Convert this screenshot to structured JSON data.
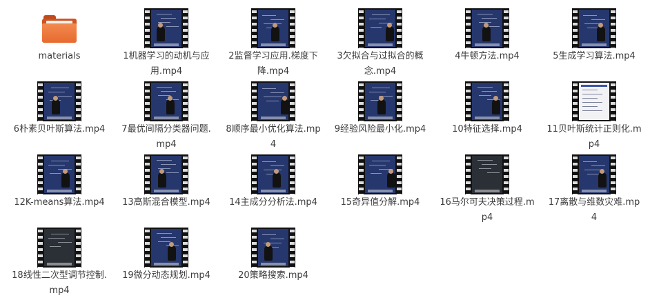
{
  "folder": {
    "name": "materials",
    "icon": "folder-icon",
    "color": "#e76a2f"
  },
  "videos": [
    {
      "name": "1机器学习的动机与应用.mp4",
      "thumb": "lecture"
    },
    {
      "name": "2监督学习应用.梯度下降.mp4",
      "thumb": "lecture"
    },
    {
      "name": "3欠拟合与过拟合的概念.mp4",
      "thumb": "lecture"
    },
    {
      "name": "4牛顿方法.mp4",
      "thumb": "lecture"
    },
    {
      "name": "5生成学习算法.mp4",
      "thumb": "lecture"
    },
    {
      "name": "6朴素贝叶斯算法.mp4",
      "thumb": "lecture"
    },
    {
      "name": "7最优间隔分类器问题.mp4",
      "thumb": "lecture"
    },
    {
      "name": "8顺序最小优化算法.mp4",
      "thumb": "lecture"
    },
    {
      "name": "9经验风险最小化.mp4",
      "thumb": "lecture"
    },
    {
      "name": "10特征选择.mp4",
      "thumb": "lecture"
    },
    {
      "name": "11贝叶斯统计正则化.mp4",
      "thumb": "slide"
    },
    {
      "name": "12K-means算法.mp4",
      "thumb": "lecture"
    },
    {
      "name": "13高斯混合模型.mp4",
      "thumb": "lecture"
    },
    {
      "name": "14主成分分析法.mp4",
      "thumb": "lecture"
    },
    {
      "name": "15奇异值分解.mp4",
      "thumb": "lecture"
    },
    {
      "name": "16马尔可夫决策过程.mp4",
      "thumb": "dark"
    },
    {
      "name": "17离散与维数灾难.mp4",
      "thumb": "lecture"
    },
    {
      "name": "18线性二次型调节控制.mp4",
      "thumb": "dark"
    },
    {
      "name": "19微分动态规划.mp4",
      "thumb": "lecture"
    },
    {
      "name": "20策略搜索.mp4",
      "thumb": "lecture"
    }
  ],
  "colors": {
    "background": "#ffffff",
    "label_text": "#3c3c3c",
    "board": "#26376e",
    "film": "#111111"
  }
}
